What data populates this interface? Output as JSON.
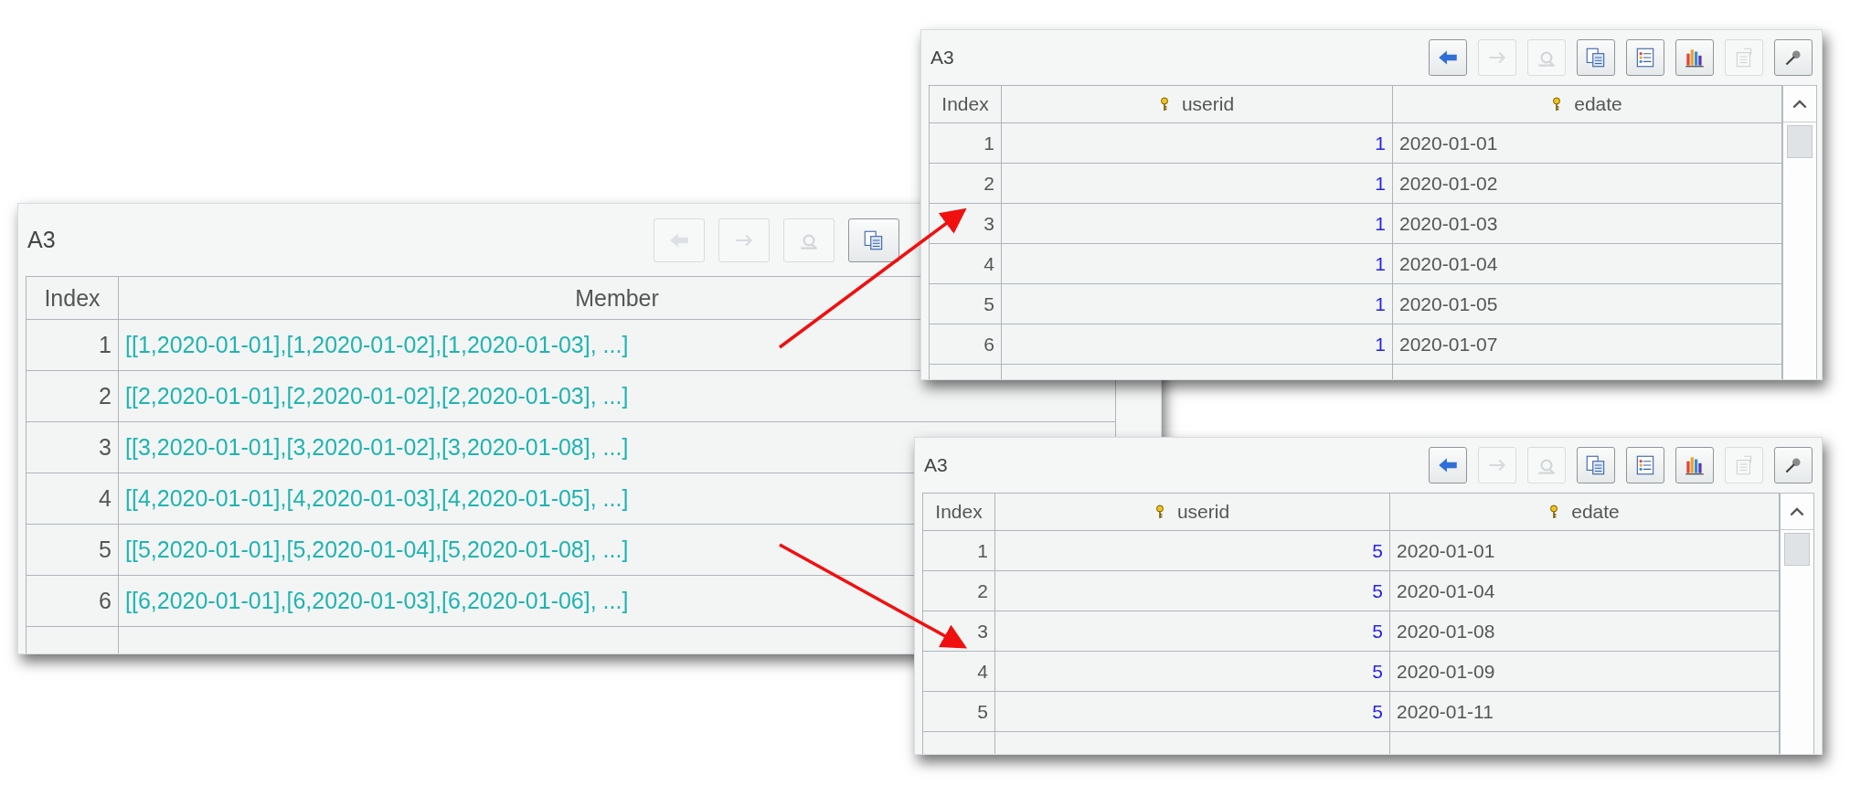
{
  "panels": [
    {
      "title": "A3",
      "toolbar": [
        {
          "kind": "back",
          "disabled": true
        },
        {
          "kind": "forward",
          "disabled": true
        },
        {
          "kind": "find",
          "disabled": true
        },
        {
          "kind": "copy",
          "disabled": false
        }
      ],
      "columns": [
        {
          "label": "Index",
          "kind": "index",
          "key": false
        },
        {
          "label": "Member",
          "kind": "sequence",
          "key": false
        }
      ],
      "rows": [
        {
          "cells": [
            "1",
            "[[1,2020-01-01],[1,2020-01-02],[1,2020-01-03], ...]"
          ]
        },
        {
          "cells": [
            "2",
            "[[2,2020-01-01],[2,2020-01-02],[2,2020-01-03], ...]"
          ]
        },
        {
          "cells": [
            "3",
            "[[3,2020-01-01],[3,2020-01-02],[3,2020-01-08], ...]"
          ]
        },
        {
          "cells": [
            "4",
            "[[4,2020-01-01],[4,2020-01-03],[4,2020-01-05], ...]"
          ]
        },
        {
          "cells": [
            "5",
            "[[5,2020-01-01],[5,2020-01-04],[5,2020-01-08], ...]"
          ]
        },
        {
          "cells": [
            "6",
            "[[6,2020-01-01],[6,2020-01-03],[6,2020-01-06], ...]"
          ]
        }
      ]
    },
    {
      "title": "A3",
      "toolbar": [
        {
          "kind": "back",
          "disabled": false
        },
        {
          "kind": "forward",
          "disabled": true
        },
        {
          "kind": "find",
          "disabled": true
        },
        {
          "kind": "copy",
          "disabled": false
        },
        {
          "kind": "list",
          "disabled": false
        },
        {
          "kind": "chart",
          "disabled": false
        },
        {
          "kind": "properties",
          "disabled": true
        },
        {
          "kind": "pin",
          "disabled": false
        }
      ],
      "columns": [
        {
          "label": "Index",
          "kind": "index",
          "key": false
        },
        {
          "label": "userid",
          "kind": "number",
          "key": true
        },
        {
          "label": "edate",
          "kind": "text",
          "key": true
        }
      ],
      "rows": [
        {
          "cells": [
            "1",
            "1",
            "2020-01-01"
          ]
        },
        {
          "cells": [
            "2",
            "1",
            "2020-01-02"
          ]
        },
        {
          "cells": [
            "3",
            "1",
            "2020-01-03"
          ]
        },
        {
          "cells": [
            "4",
            "1",
            "2020-01-04"
          ]
        },
        {
          "cells": [
            "5",
            "1",
            "2020-01-05"
          ]
        },
        {
          "cells": [
            "6",
            "1",
            "2020-01-07"
          ]
        }
      ]
    },
    {
      "title": "A3",
      "toolbar": [
        {
          "kind": "back",
          "disabled": false
        },
        {
          "kind": "forward",
          "disabled": true
        },
        {
          "kind": "find",
          "disabled": true
        },
        {
          "kind": "copy",
          "disabled": false
        },
        {
          "kind": "list",
          "disabled": false
        },
        {
          "kind": "chart",
          "disabled": false
        },
        {
          "kind": "properties",
          "disabled": true
        },
        {
          "kind": "pin",
          "disabled": false
        }
      ],
      "columns": [
        {
          "label": "Index",
          "kind": "index",
          "key": false
        },
        {
          "label": "userid",
          "kind": "number",
          "key": true
        },
        {
          "label": "edate",
          "kind": "text",
          "key": true
        }
      ],
      "rows": [
        {
          "cells": [
            "1",
            "5",
            "2020-01-01"
          ]
        },
        {
          "cells": [
            "2",
            "5",
            "2020-01-04"
          ]
        },
        {
          "cells": [
            "3",
            "5",
            "2020-01-08"
          ]
        },
        {
          "cells": [
            "4",
            "5",
            "2020-01-09"
          ]
        },
        {
          "cells": [
            "5",
            "5",
            "2020-01-11"
          ]
        }
      ]
    }
  ]
}
